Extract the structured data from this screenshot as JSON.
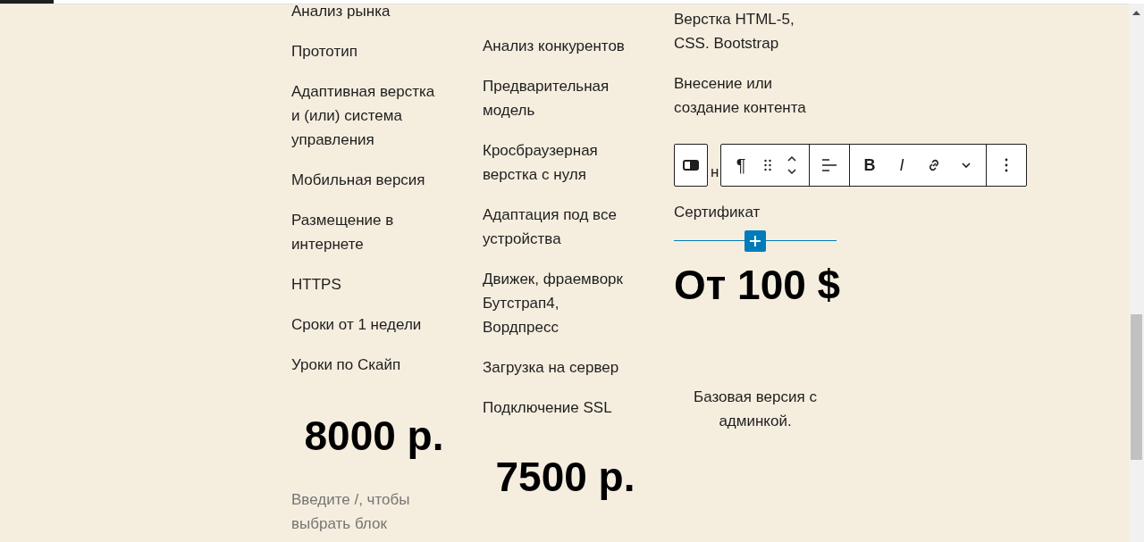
{
  "columns": [
    {
      "items": [
        "Анализ рынка",
        "Прототип",
        "Адаптивная верстка и (или) система управления",
        "Мобильная версия",
        "Размещение в интернете",
        "HTTPS",
        "Сроки от 1 недели",
        "Уроки по Скайп"
      ],
      "price": "8000 р.",
      "placeholder": "Введите /, чтобы выбрать блок"
    },
    {
      "items": [
        "Анализ конкурентов",
        "Предварительная модель",
        "Кросбраузерная верстка с нуля",
        "Адаптация под все устройства",
        "Движек, фраемворк Бутстрап4, Вордпресс",
        "Загрузка на сервер",
        "Подключение SSL"
      ],
      "price": "7500 р."
    },
    {
      "items": [
        "Верстка HTML-5, CSS. Bootstrap",
        "Внесение или создание контента"
      ],
      "covered_text": "н",
      "items_after": [
        "Сертификат"
      ],
      "price": "От 100 $",
      "note": "Базовая версия с админкой."
    }
  ],
  "toolbar": {
    "paragraph_glyph": "¶",
    "bold": "B",
    "italic": "I"
  }
}
